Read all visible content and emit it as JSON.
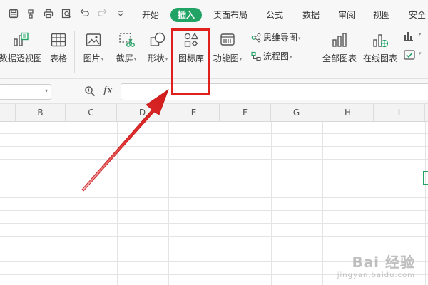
{
  "quick_access": {
    "icons": [
      "save-icon",
      "format-painter-icon",
      "print-icon",
      "print-preview-icon",
      "undo-icon",
      "redo-icon",
      "more-icon"
    ]
  },
  "tabs": [
    {
      "label": "开始",
      "active": false
    },
    {
      "label": "插入",
      "active": true
    },
    {
      "label": "页面布局",
      "active": false
    },
    {
      "label": "公式",
      "active": false
    },
    {
      "label": "数据",
      "active": false
    },
    {
      "label": "审阅",
      "active": false
    },
    {
      "label": "视图",
      "active": false
    },
    {
      "label": "安全",
      "active": false
    }
  ],
  "ribbon": {
    "pivot_chart": "数据透视图",
    "table": "表格",
    "picture": "图片",
    "screenshot": "截屏",
    "shapes": "形状",
    "icon_library": "图标库",
    "function_chart": "功能图",
    "mind_map": "思维导图",
    "flowchart": "流程图",
    "all_charts": "全部图表",
    "online_charts": "在线图表"
  },
  "formula_bar": {
    "fx_label": "fx",
    "formula_value": ""
  },
  "columns": [
    "B",
    "C",
    "D",
    "E",
    "F",
    "G",
    "H",
    "I"
  ],
  "watermark": {
    "main": "Bai 经验",
    "sub": "jingyan.baidu.com"
  },
  "colors": {
    "accent": "#21a366",
    "annotation": "#e0201c"
  }
}
